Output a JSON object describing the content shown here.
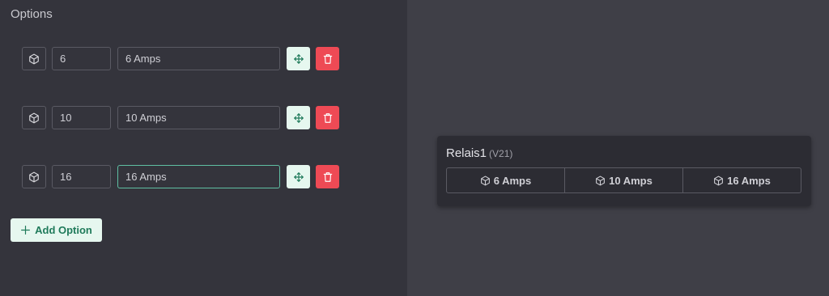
{
  "options_panel": {
    "title": "Options",
    "rows": [
      {
        "value": "6",
        "label": "6 Amps"
      },
      {
        "value": "10",
        "label": "10 Amps"
      },
      {
        "value": "16",
        "label": "16 Amps"
      }
    ],
    "add_option_label": "Add Option"
  },
  "preview": {
    "title": "Relais1",
    "version": "(V21)",
    "segments": [
      "6 Amps",
      "10 Amps",
      "16 Amps"
    ]
  },
  "colors": {
    "accent": "#1f7a5a",
    "danger": "#ee4a55",
    "focus": "#5fbfa3"
  },
  "icons": {
    "row_icon": "cube-icon",
    "move_icon": "move-icon",
    "delete_icon": "trash-icon",
    "add_icon": "plus-icon",
    "segment_icon": "cube-icon"
  }
}
